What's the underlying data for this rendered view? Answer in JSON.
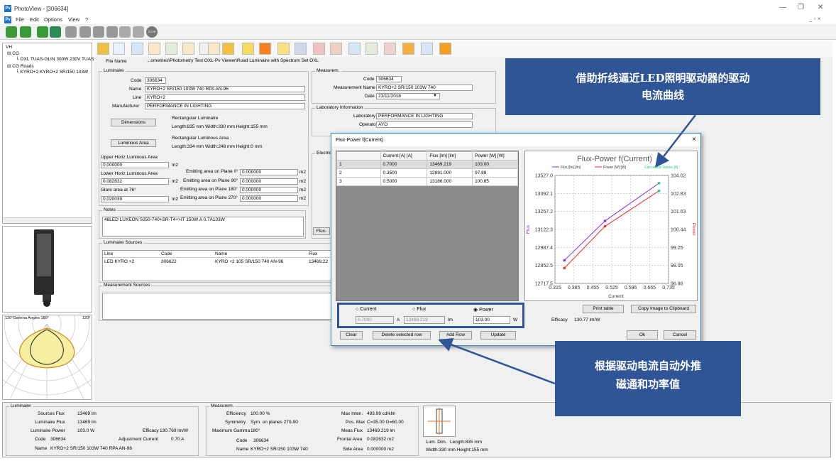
{
  "window": {
    "title": "PhotoView - [306634]",
    "app_icon": "Pv",
    "doc_title_icon": "Pv"
  },
  "menu": [
    "File",
    "Edit",
    "Options",
    "View",
    "?"
  ],
  "tree": {
    "root": "VH",
    "items": [
      "CG",
      "OXL TUAS-GLIN 300W 230V TUAS",
      "CG Roads",
      "KYRO+2 KYRO+2 SR/150 103W"
    ]
  },
  "file": {
    "label": "File Name",
    "value": "...ometries\\Photometry Test OXL-Pv Viewer\\Road Luminaire with Spectrum Set OXL"
  },
  "luminaire": {
    "group": "Luminaire",
    "code_label": "Code",
    "code": "306634",
    "name_label": "Name",
    "name": "KYRO+2 SR/150 103W 740 RPA AN-96",
    "line_label": "Line",
    "line": "KYRO+2",
    "manufacturer_label": "Manufacturer",
    "manufacturer": "PERFORMANCE IN LIGHTING",
    "dimensions_btn": "Dimensions",
    "dim_shape": "Rectangular Luminaire",
    "dim_values": "Length:835 mm  Width:330 mm  Height:155 mm",
    "lum_area_btn": "Luminous Area",
    "area_shape": "Rectangular Luminous Area",
    "area_values": "Length:334 mm  Width:248 mm  Height:0 mm"
  },
  "areas": {
    "upper_label": "Upper Horiz Luminous Area",
    "upper": "0.000000",
    "lower_label": "Lower Horiz Luminous Area",
    "lower": "0.082832",
    "glare_label": "Glare area at 76°",
    "glare": "0.020039",
    "unit": "m2",
    "plane0_label": "Emitting area on Plane 0°",
    "plane0": "0.000000",
    "plane90_label": "Emitting area on Plane 90°",
    "plane90": "0.000000",
    "plane180_label": "Emitting area on Plane 180°",
    "plane180": "0.000000",
    "plane270_label": "Emitting area on Plane 270°",
    "plane270": "0.000000"
  },
  "notes": {
    "label": "Notes",
    "value": "48LED LUXEON 5050-740+SR-T4+>IT 150W A 0.7A103W"
  },
  "sources": {
    "label": "Luminaire Sources",
    "headers": [
      "Line",
      "Code",
      "Name",
      "Flux"
    ],
    "rows": [
      [
        "LED KYRO +2",
        "306622",
        "KYRO +2 105 SR/150 740 AN-96",
        "13469.22"
      ]
    ]
  },
  "meas_sources_label": "Measurement Sources",
  "measurement": {
    "group": "Measurem.",
    "code_label": "Code",
    "code": "306634",
    "name_label": "Measurement Name",
    "name": "KYRO+2 SR/150 103W 740",
    "date_label": "Date",
    "date": "23/11/2018"
  },
  "lab": {
    "group": "Laboratory Information",
    "lab_label": "Laboratory",
    "lab": "PERFORMANCE IN LIGHTING",
    "operator_label": "Operator",
    "operator": "AYO"
  },
  "electrical_group": "Electric",
  "flux_tab": "Flux-",
  "dialog": {
    "title": "Flux-Power f(Current)",
    "headers": [
      "",
      "Current [A] [A]",
      "Flux [lm] [lm]",
      "Power [W] [W]"
    ],
    "rows": [
      [
        "1",
        "0.7000",
        "13469.219",
        "103.00"
      ],
      [
        "2",
        "0.3500",
        "12891.000",
        "97.88"
      ],
      [
        "3",
        "0.5000",
        "13186.000",
        "100.65"
      ]
    ],
    "radio_current": "Current",
    "radio_flux": "Flux",
    "radio_power": "Power",
    "in_current": "0.7000",
    "unit_a": "A",
    "in_flux": "13469.219",
    "unit_lm": "lm",
    "in_power": "103.00",
    "unit_w": "W",
    "btn_clear": "Clear",
    "btn_delete": "Delete selected row",
    "btn_add": "Add Row",
    "btn_update": "Update",
    "btn_print": "Print table",
    "btn_copy": "Copy Image to Clipboard",
    "efficacy_label": "Efficacy",
    "efficacy": "130.77 lm/W",
    "btn_ok": "Ok",
    "btn_cancel": "Cancel"
  },
  "chart_data": {
    "type": "line",
    "title": "Flux-Power f(Current)",
    "xlabel": "Current",
    "ylabel": "Flux",
    "y2label": "Power",
    "legend": [
      "Flux [lm] [lm]",
      "Power [W] [W]",
      "Calculated Values [A]"
    ],
    "xlim": [
      0.315,
      0.735
    ],
    "x_ticks": [
      "0.315",
      "0.385",
      "0.455",
      "0.525",
      "0.595",
      "0.665",
      "0.735"
    ],
    "ylim": [
      12717.5,
      13527.0
    ],
    "y_ticks": [
      "13527.0",
      "13392.1",
      "13257.2",
      "13122.3",
      "12987.4",
      "12852.5",
      "12717.5"
    ],
    "y2lim": [
      96.86,
      104.02
    ],
    "y2_ticks": [
      "104.02",
      "102.83",
      "101.63",
      "100.44",
      "99.25",
      "98.05",
      "96.86"
    ],
    "series": [
      {
        "name": "Flux [lm] [lm]",
        "color": "#8a2be2",
        "axis": "left",
        "x": [
          0.35,
          0.5,
          0.7
        ],
        "y": [
          12891.0,
          13186.0,
          13469.219
        ]
      },
      {
        "name": "Power [W] [W]",
        "color": "#e83030",
        "axis": "right",
        "x": [
          0.35,
          0.5,
          0.7
        ],
        "y": [
          97.88,
          100.65,
          103.0
        ]
      }
    ],
    "calc_color": "#22cc77"
  },
  "bottom": {
    "lum_group": "Luminaire",
    "sources_flux_label": "Sources Flux",
    "sources_flux": "13469 lm",
    "lum_flux_label": "Luminaire Flux",
    "lum_flux": "13469 lm",
    "lum_power_label": "Luminaire Power",
    "lum_power": "103.0 W",
    "efficacy_label": "Efficacy",
    "efficacy": "130.769 lm/W",
    "code_label": "Code",
    "code": "306634",
    "adj_label": "Adjustment Current",
    "adj": "0.70 A",
    "name_label": "Name",
    "name": "KYRO+2 SR/150 103W 740 RPA AN-96",
    "meas_group": "Measurem.",
    "efficiency_label": "Efficiency",
    "efficiency": "100.00 %",
    "symmetry_label": "Symmetry",
    "symmetry": "Sym. on planes 270-90",
    "maxgamma_label": "Maximum Gamma",
    "maxgamma": "180°",
    "mcode_label": "Code",
    "mcode": "306634",
    "mname_label": "Name",
    "mname": "KYRO+2 SR/150 103W 740",
    "maxint_label": "Max Inten.",
    "maxint": "493.99  cd/klm",
    "posmax_label": "Pos. Max",
    "posmax": "C=35.00 G=60.00",
    "measflux_label": "Meas.Flux",
    "measflux": "13469.219 lm",
    "frontal_label": "Frontal Area",
    "frontal": "0.082832 m2",
    "side_label": "Side Area",
    "side": "0.000000 m2",
    "lumdim_label": "Lum. Dim.",
    "lumdim_length": "Length:835 mm",
    "lumdim_wh": "Width:330 mm Height:155 mm"
  },
  "polar": {
    "title": "120°Gamma Angles  180°",
    "top_right": "120°"
  },
  "annotations": {
    "top_line1": "借助折线逼近LED照明驱动器的驱动",
    "top_line2": "电流曲线",
    "bottom_line1": "根据驱动电流自动外推",
    "bottom_line2": "磁通和功率值"
  }
}
